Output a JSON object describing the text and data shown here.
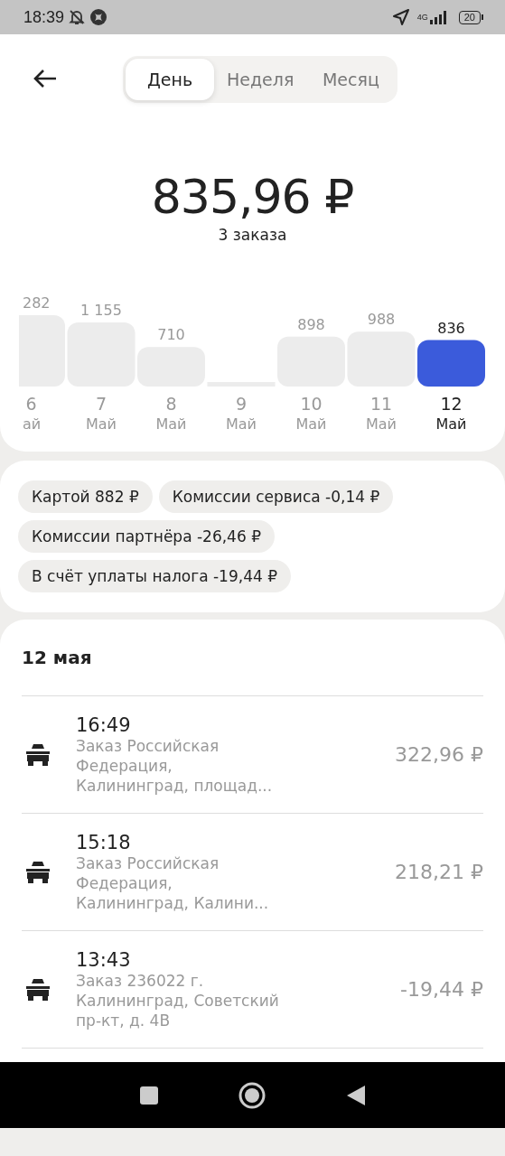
{
  "status_bar": {
    "time": "18:39",
    "network": "4G",
    "battery": "20"
  },
  "tabs": [
    {
      "label": "День",
      "selected": true
    },
    {
      "label": "Неделя",
      "selected": false
    },
    {
      "label": "Месяц",
      "selected": false
    }
  ],
  "summary": {
    "total": "835,96 ₽",
    "orders": "3 заказа"
  },
  "chart": {
    "cut_column": {
      "amount": "282",
      "day": "6",
      "month": "ай"
    },
    "chart_data": {
      "type": "bar",
      "categories": [
        "7",
        "8",
        "9",
        "10",
        "11",
        "12"
      ],
      "values": [
        1155,
        710,
        0,
        898,
        988,
        836
      ],
      "value_labels": [
        "1 155",
        "710",
        null,
        "898",
        "988",
        "836"
      ]
    },
    "bars": [
      {
        "month": "Май",
        "selected": false
      },
      {
        "month": "Май",
        "selected": false
      },
      {
        "month": "Май",
        "selected": false
      },
      {
        "month": "Май",
        "selected": false
      },
      {
        "month": "Май",
        "selected": false
      },
      {
        "month": "Май",
        "selected": true
      }
    ]
  },
  "breakdown": [
    "Картой 882 ₽",
    "Комиссии сервиса -0,14 ₽",
    "Комиссии партнёра -26,46 ₽",
    "В счёт уплаты налога -19,44 ₽"
  ],
  "orders_section": {
    "date": "12 мая",
    "orders": [
      {
        "time": "16:49",
        "description": "Заказ Российская Федерация, Калининград, площад...",
        "amount": "322,96 ₽"
      },
      {
        "time": "15:18",
        "description": "Заказ Российская Федерация, Калининград, Калини...",
        "amount": "218,21 ₽"
      },
      {
        "time": "13:43",
        "description": "Заказ 236022 г. Калининград, Советский пр-кт, д. 4В",
        "amount": "-19,44 ₽"
      }
    ]
  }
}
